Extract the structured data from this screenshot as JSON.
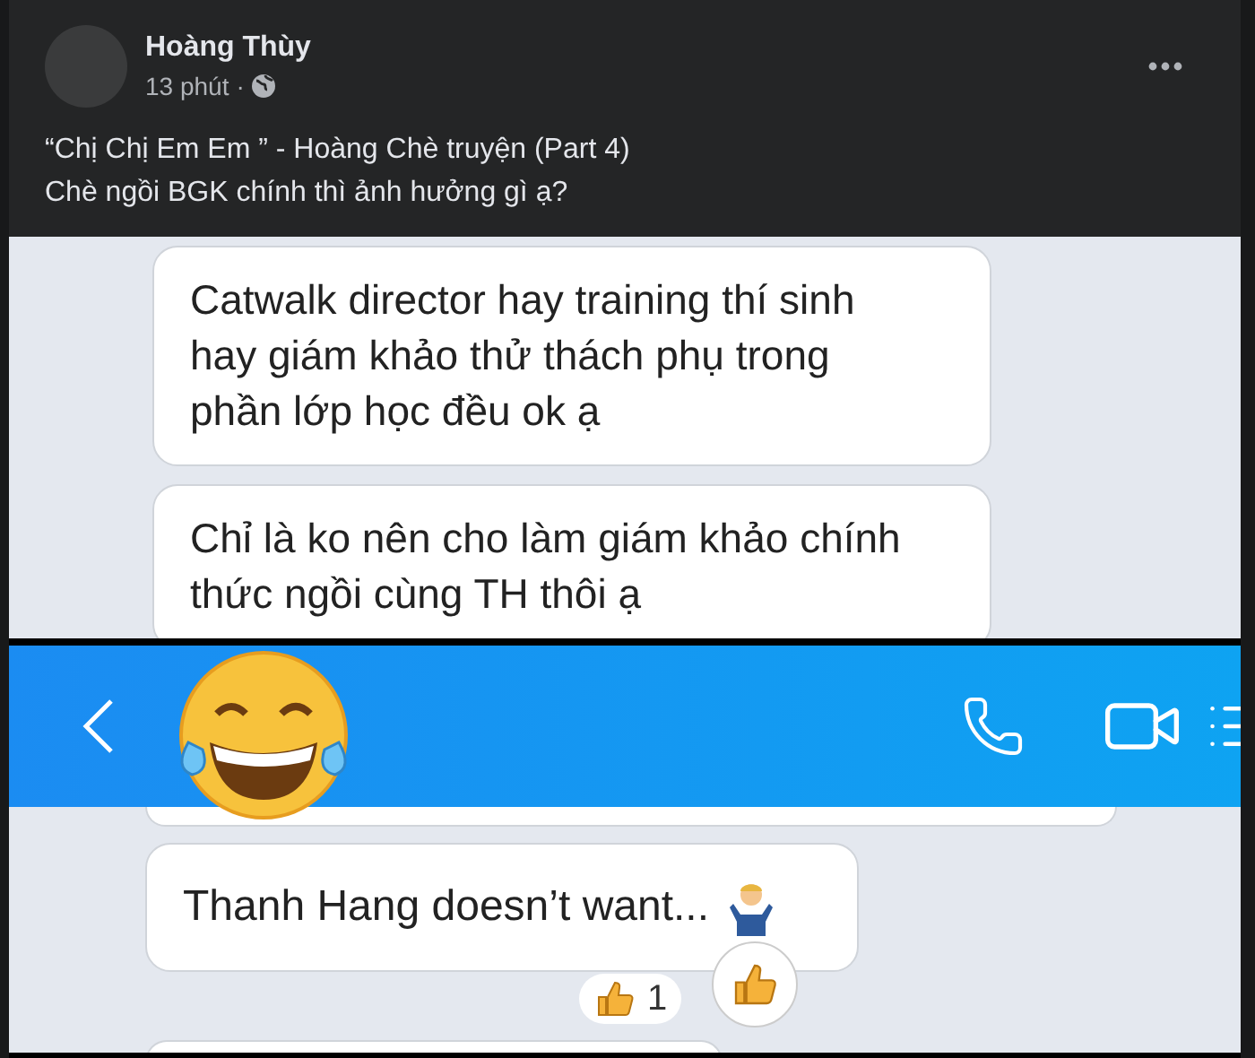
{
  "post": {
    "author": "Hoàng Thùy",
    "time": "13 phút",
    "separator": "·",
    "caption": [
      "“Chị Chị Em Em ” - Hoàng Chè truyện (Part 4)",
      "Chè ngồi BGK chính thì ảnh hưởng gì ạ?"
    ]
  },
  "chat_top": {
    "messages": [
      "Catwalk director hay training thí sinh hay giám khảo thử thách phụ trong phần lớp học đều ok ạ",
      "Chỉ là ko nên cho làm giám khảo chính thức ngồi cùng TH thôi ạ"
    ]
  },
  "chat_bottom": {
    "message": "Thanh Hang doesn’t want...",
    "reaction_count": "1"
  }
}
